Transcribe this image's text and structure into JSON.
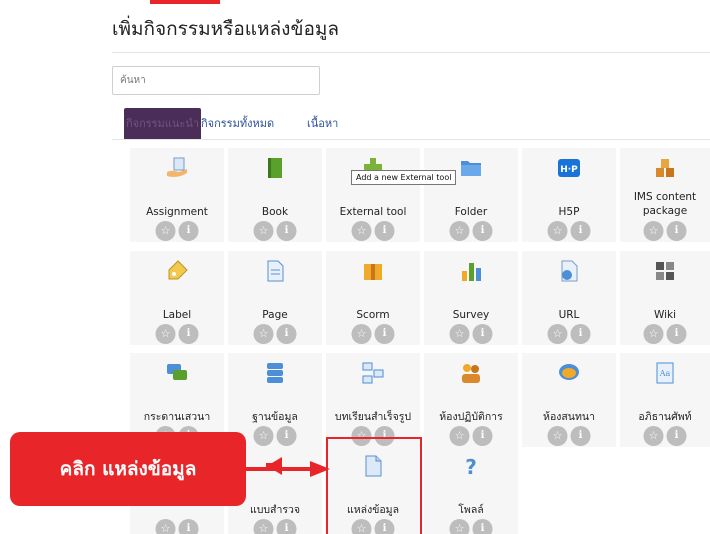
{
  "header": {
    "title": "เพิ่มกิจกรรมหรือแหล่งข้อมูล"
  },
  "search": {
    "placeholder": "ค้นหา"
  },
  "tabs": [
    {
      "label": "กิจกรรมแนะนำ",
      "active": true
    },
    {
      "label": "กิจกรรมทั้งหมด",
      "active": false
    },
    {
      "label": "เนื้อหา",
      "active": false
    }
  ],
  "tooltip": {
    "text": "Add a new External tool"
  },
  "callout": {
    "text": "คลิก แหล่งข้อมูล"
  },
  "buttons": {
    "star": "☆",
    "info": "i"
  },
  "modules": [
    {
      "name": "Assignment",
      "icon": "assignment-icon"
    },
    {
      "name": "Book",
      "icon": "book-icon"
    },
    {
      "name": "External tool",
      "icon": "external-tool-icon"
    },
    {
      "name": "Folder",
      "icon": "folder-icon"
    },
    {
      "name": "H5P",
      "icon": "h5p-icon"
    },
    {
      "name": "IMS content package",
      "icon": "ims-package-icon"
    },
    {
      "name": "Label",
      "icon": "label-tag-icon"
    },
    {
      "name": "Page",
      "icon": "page-icon"
    },
    {
      "name": "Scorm",
      "icon": "scorm-box-icon"
    },
    {
      "name": "Survey",
      "icon": "survey-bar-chart-icon"
    },
    {
      "name": "URL",
      "icon": "url-globe-icon"
    },
    {
      "name": "Wiki",
      "icon": "wiki-icon"
    },
    {
      "name": "กระดานเสวนา",
      "icon": "forum-speech-bubbles-icon"
    },
    {
      "name": "ฐานข้อมูล",
      "icon": "database-icon"
    },
    {
      "name": "บทเรียนสำเร็จรูป",
      "icon": "lesson-flow-icon"
    },
    {
      "name": "ห้องปฏิบัติการ",
      "icon": "workshop-people-icon"
    },
    {
      "name": "ห้องสนทนา",
      "icon": "chat-bubble-icon"
    },
    {
      "name": "อภิธานศัพท์",
      "icon": "glossary-icon"
    },
    {
      "name": "",
      "icon": ""
    },
    {
      "name": "แบบสำรวจ",
      "icon": "feedback-megaphone-icon"
    },
    {
      "name": "แหล่งข้อมูล",
      "icon": "resource-file-icon"
    },
    {
      "name": "โพลล์",
      "icon": "choice-question-icon"
    }
  ],
  "colors": {
    "accent_red": "#e8262a",
    "tab_active_bg": "#4a2e58",
    "tile_bg": "#f6f6f6",
    "link_blue": "#2b4f9c"
  }
}
